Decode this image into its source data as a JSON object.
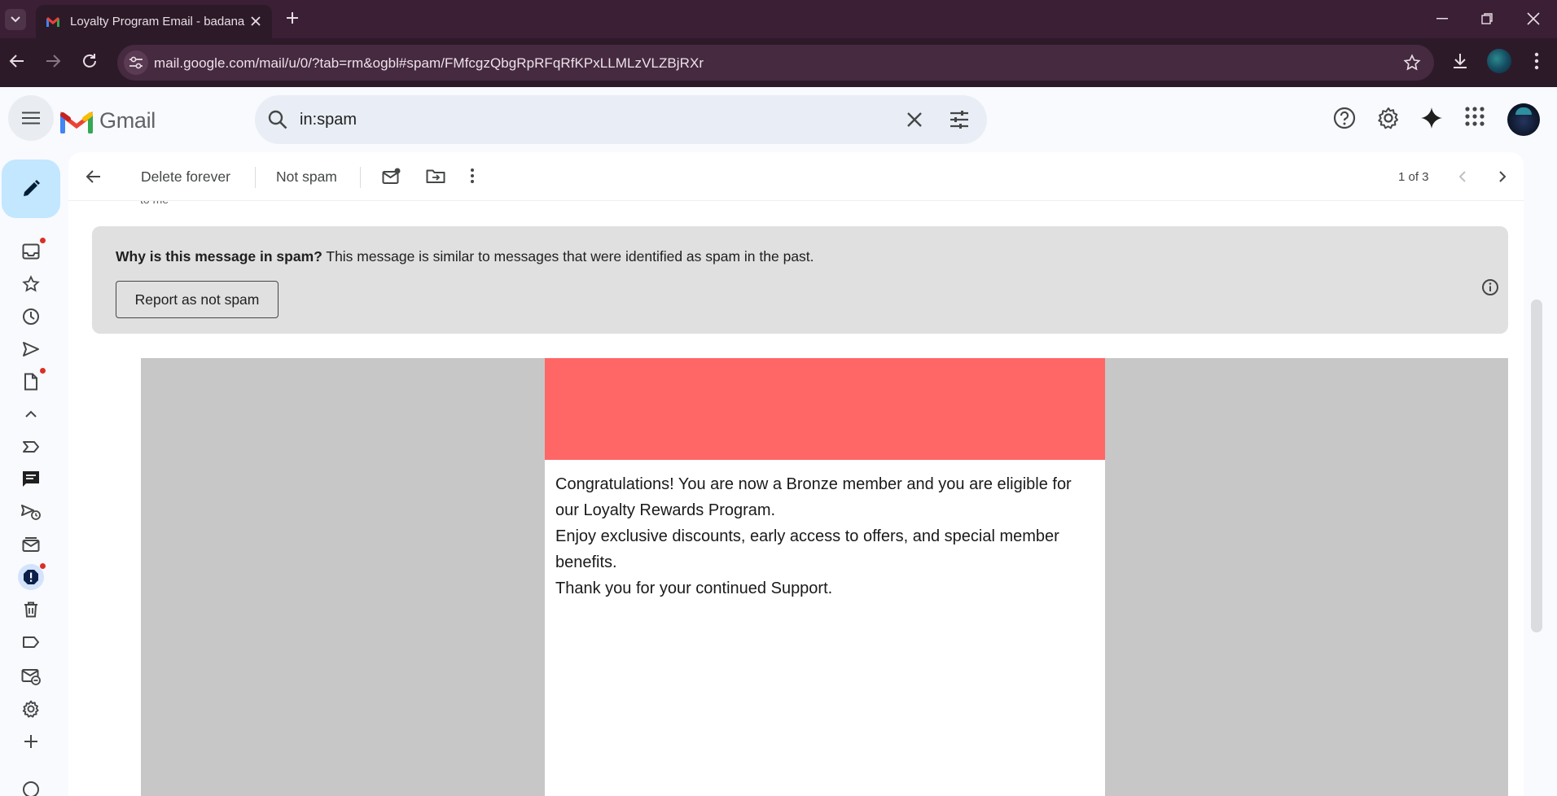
{
  "browser": {
    "tab_title": "Loyalty Program Email - badana",
    "url": "mail.google.com/mail/u/0/?tab=rm&ogbl#spam/FMfcgzQbgRpRFqRfKPxLLMLzVLZBjRXr"
  },
  "gmail": {
    "wordmark": "Gmail",
    "search_query": "in:spam"
  },
  "toolbar": {
    "delete_forever": "Delete forever",
    "not_spam": "Not spam",
    "pager": "1 of 3"
  },
  "message": {
    "to_line": "to me",
    "spam_reason_bold": "Why is this message in spam?",
    "spam_reason_text": " This message is similar to messages that were identified as spam in the past.",
    "report_button": "Report as not spam",
    "body_lines": [
      "Congratulations! You are now a Bronze member and you are eligible for our Loyalty Rewards Program.",
      "Enjoy exclusive discounts, early access to offers, and special member benefits.",
      "Thank you for your continued Support."
    ],
    "hero_color": "#ff6666"
  },
  "colors": {
    "chrome_bg": "#3a1f35",
    "compose_bg": "#c2e7ff",
    "spam_banner_bg": "#e0e0e0",
    "email_outer_bg": "#c7c7c7",
    "unread_dot": "#d93025"
  },
  "rail_icons": [
    "inbox-icon",
    "star-icon",
    "snoozed-icon",
    "sent-icon",
    "drafts-icon",
    "less-icon",
    "important-icon",
    "chats-icon",
    "scheduled-icon",
    "all-mail-icon",
    "spam-icon",
    "trash-icon",
    "label-icon",
    "manage-subscriptions-icon",
    "settings-icon",
    "new-label-icon"
  ]
}
